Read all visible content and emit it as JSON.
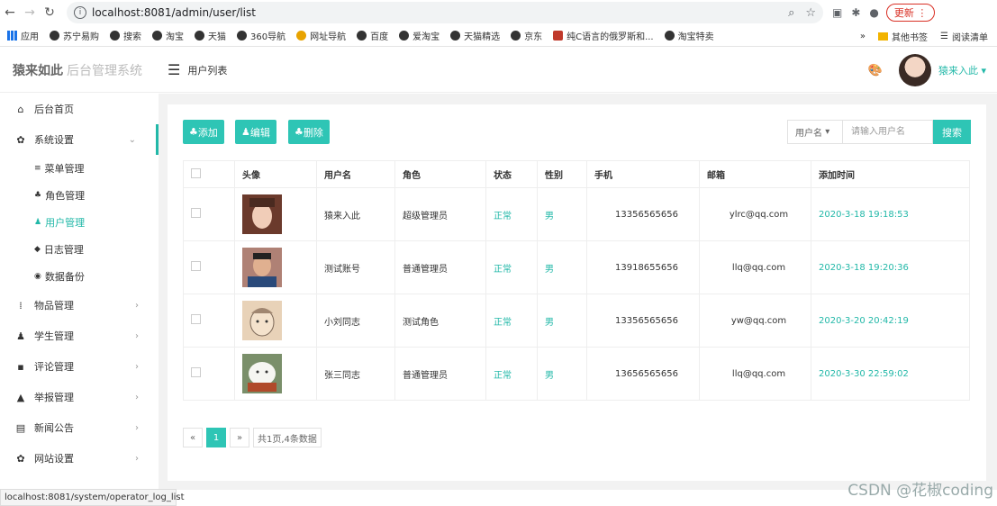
{
  "browser": {
    "url": "localhost:8081/admin/user/list",
    "update_label": "更新",
    "bookmarks": [
      "应用",
      "苏宁易购",
      "搜索",
      "淘宝",
      "天猫",
      "360导航",
      "网址导航",
      "百度",
      "爱淘宝",
      "天猫精选",
      "京东",
      "纯C语言的俄罗斯和...",
      "淘宝特卖"
    ],
    "more": "»",
    "other_bookmarks": "其他书签",
    "reading_list": "阅读清单"
  },
  "app": {
    "logo_main": "猿来如此",
    "logo_sub": "后台管理系统",
    "page_title": "用户列表",
    "username": "猿来入此",
    "accent": "#2ec5b5"
  },
  "sidebar": {
    "items": [
      {
        "label": "后台首页",
        "icon": "home-icon"
      },
      {
        "label": "系统设置",
        "icon": "gear-icon"
      },
      {
        "label": "物品管理",
        "icon": "grid-icon"
      },
      {
        "label": "学生管理",
        "icon": "users-icon"
      },
      {
        "label": "评论管理",
        "icon": "comment-icon"
      },
      {
        "label": "举报管理",
        "icon": "warning-icon"
      },
      {
        "label": "新闻公告",
        "icon": "news-icon"
      },
      {
        "label": "网站设置",
        "icon": "gear-icon"
      }
    ],
    "subitems": [
      {
        "label": "菜单管理",
        "icon": "list-icon"
      },
      {
        "label": "角色管理",
        "icon": "role-icon"
      },
      {
        "label": "用户管理",
        "icon": "users-icon"
      },
      {
        "label": "日志管理",
        "icon": "tag-icon"
      },
      {
        "label": "数据备份",
        "icon": "database-icon"
      }
    ]
  },
  "toolbar": {
    "add": "添加",
    "edit": "编辑",
    "delete": "删除",
    "filter_select": "用户名",
    "search_placeholder": "请输入用户名",
    "search": "搜索"
  },
  "table": {
    "headers": [
      "头像",
      "用户名",
      "角色",
      "状态",
      "性别",
      "手机",
      "邮箱",
      "添加时间"
    ],
    "rows": [
      {
        "username": "猿来入此",
        "role": "超级管理员",
        "status": "正常",
        "gender": "男",
        "phone": "13356565656",
        "email": "ylrc@qq.com",
        "added": "2020-3-18 19:18:53"
      },
      {
        "username": "测试账号",
        "role": "普通管理员",
        "status": "正常",
        "gender": "男",
        "phone": "13918655656",
        "email": "llq@qq.com",
        "added": "2020-3-18 19:20:36"
      },
      {
        "username": "小刘同志",
        "role": "测试角色",
        "status": "正常",
        "gender": "男",
        "phone": "13356565656",
        "email": "yw@qq.com",
        "added": "2020-3-20 20:42:19"
      },
      {
        "username": "张三同志",
        "role": "普通管理员",
        "status": "正常",
        "gender": "男",
        "phone": "13656565656",
        "email": "llq@qq.com",
        "added": "2020-3-30 22:59:02"
      }
    ]
  },
  "pagination": {
    "prev": "«",
    "current": "1",
    "next": "»",
    "info": "共1页,4条数据"
  },
  "statusbar": "localhost:8081/system/operator_log_list",
  "watermark": "CSDN @花椒coding"
}
